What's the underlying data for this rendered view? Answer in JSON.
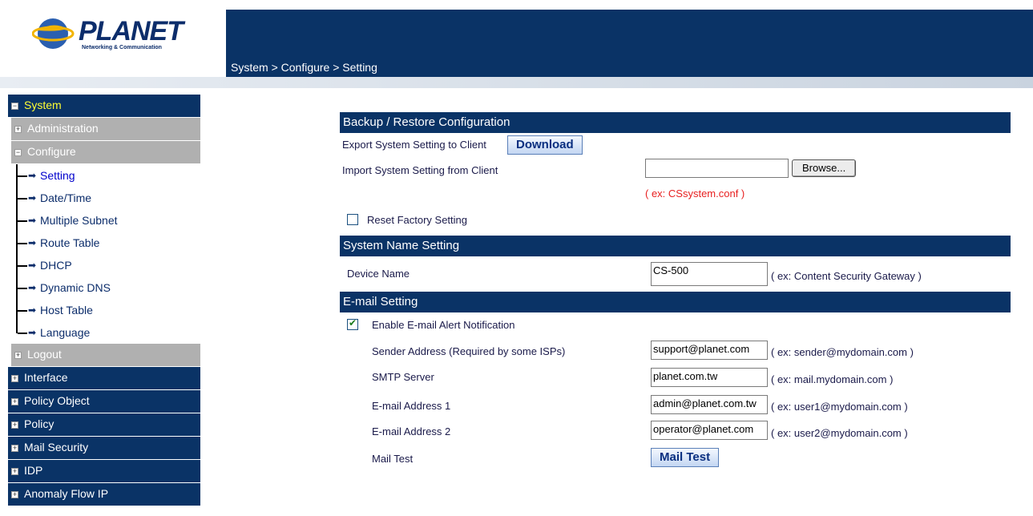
{
  "logo": {
    "name": "PLANET",
    "tagline": "Networking & Communication"
  },
  "breadcrumb": "System > Configure > Setting",
  "sidebar": {
    "system": "System",
    "administration": "Administration",
    "configure": "Configure",
    "sub_items": [
      "Setting",
      "Date/Time",
      "Multiple Subnet",
      "Route Table",
      "DHCP",
      "Dynamic DNS",
      "Host Table",
      "Language"
    ],
    "logout": "Logout",
    "sections": [
      "Interface",
      "Policy Object",
      "Policy",
      "Mail Security",
      "IDP",
      "Anomaly Flow IP"
    ]
  },
  "backup": {
    "title": "Backup / Restore Configuration",
    "export_label": "Export System Setting to Client",
    "download_button": "Download",
    "import_label": "Import System Setting from Client",
    "import_value": "",
    "browse_button": "Browse...",
    "example": "( ex: CSsystem.conf )",
    "reset_label": "Reset Factory Setting",
    "reset_checked": false
  },
  "system_name": {
    "title": "System Name Setting",
    "device_label": "Device Name",
    "device_value": "CS-500",
    "device_hint": "( ex: Content Security Gateway )"
  },
  "email": {
    "title": "E-mail Setting",
    "enable_label": "Enable E-mail Alert Notification",
    "enable_checked": true,
    "sender_label": "Sender Address  (Required by some ISPs)",
    "sender_value": "support@planet.com",
    "sender_hint": "( ex: sender@mydomain.com )",
    "smtp_label": "SMTP Server",
    "smtp_value": "planet.com.tw",
    "smtp_hint": "( ex: mail.mydomain.com )",
    "addr1_label": "E-mail Address 1",
    "addr1_value": "admin@planet.com.tw",
    "addr1_hint": "( ex: user1@mydomain.com )",
    "addr2_label": "E-mail Address 2",
    "addr2_value": "operator@planet.com",
    "addr2_hint": "( ex: user2@mydomain.com )",
    "mailtest_label": "Mail Test",
    "mailtest_button": "Mail Test"
  },
  "colors": {
    "navy": "#0a3366",
    "gray_item": "#b0b0b0",
    "highlight": "#ffff33",
    "example_red": "#e82020"
  }
}
